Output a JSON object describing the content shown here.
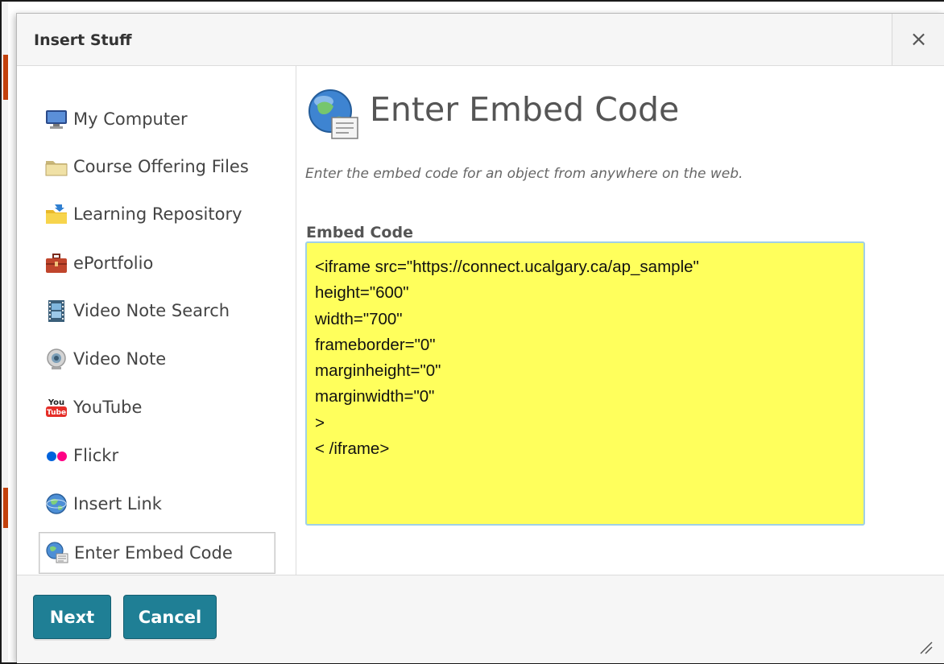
{
  "dialog": {
    "title": "Insert Stuff",
    "close_label": "×"
  },
  "sidebar": {
    "items": [
      {
        "label": "My Computer",
        "icon": "monitor-icon"
      },
      {
        "label": "Course Offering Files",
        "icon": "folder-icon"
      },
      {
        "label": "Learning Repository",
        "icon": "repository-folder-icon"
      },
      {
        "label": "ePortfolio",
        "icon": "briefcase-icon"
      },
      {
        "label": "Video Note Search",
        "icon": "film-strip-icon"
      },
      {
        "label": "Video Note",
        "icon": "webcam-icon"
      },
      {
        "label": "YouTube",
        "icon": "youtube-icon"
      },
      {
        "label": "Flickr",
        "icon": "flickr-icon"
      },
      {
        "label": "Insert Link",
        "icon": "globe-link-icon"
      },
      {
        "label": "Enter Embed Code",
        "icon": "globe-document-icon",
        "selected": true
      }
    ]
  },
  "main": {
    "title": "Enter Embed Code",
    "description": "Enter the embed code for an object from anywhere on the web.",
    "field_label": "Embed Code",
    "embed_code": "<iframe src=\"https://connect.ucalgary.ca/ap_sample\"\nheight=\"600\"\nwidth=\"700\"\nframeborder=\"0\"\nmarginheight=\"0\"\nmarginwidth=\"0\"\n>\n< /iframe>"
  },
  "footer": {
    "next_label": "Next",
    "cancel_label": "Cancel"
  },
  "colors": {
    "button": "#1f7f95",
    "embed_background": "#ffff5c",
    "embed_border": "#9fd0e6"
  }
}
